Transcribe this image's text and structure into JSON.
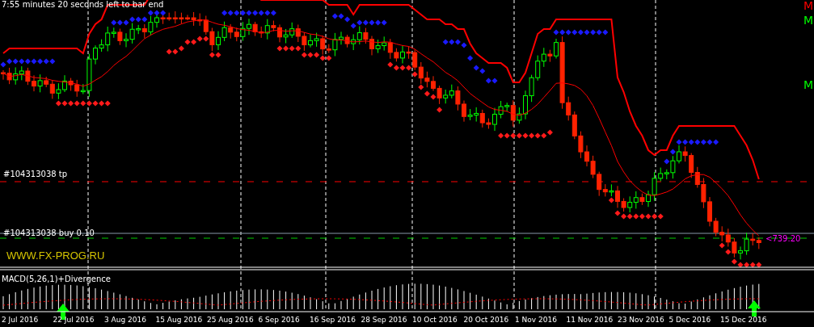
{
  "status": {
    "countdown": "7:55 minutes 20 seconds left to bar end"
  },
  "edge_labels": [
    {
      "text": "M",
      "color": "#ff0000"
    },
    {
      "text": "M",
      "color": "#00ff00"
    },
    {
      "text": "M",
      "color": "#00ff00"
    }
  ],
  "orders": [
    {
      "label": "#104313038 tp",
      "kind": "tp"
    },
    {
      "label": "#104313038 buy 0.10",
      "kind": "buy"
    }
  ],
  "price_tag": "<739.20",
  "site_label": "WWW.FX-PROG.RU",
  "indicator": {
    "label": "MACD(5,26,1)+Divergence"
  },
  "time_axis": {
    "labels": [
      "2 Jul 2016",
      "22 Jul 2016",
      "3 Aug 2016",
      "15 Aug 2016",
      "25 Aug 2016",
      "6 Sep 2016",
      "16 Sep 2016",
      "28 Sep 2016",
      "10 Oct 2016",
      "20 Oct 2016",
      "1 Nov 2016",
      "11 Nov 2016",
      "23 Nov 2016",
      "5 Dec 2016",
      "15 Dec 2016"
    ]
  }
}
